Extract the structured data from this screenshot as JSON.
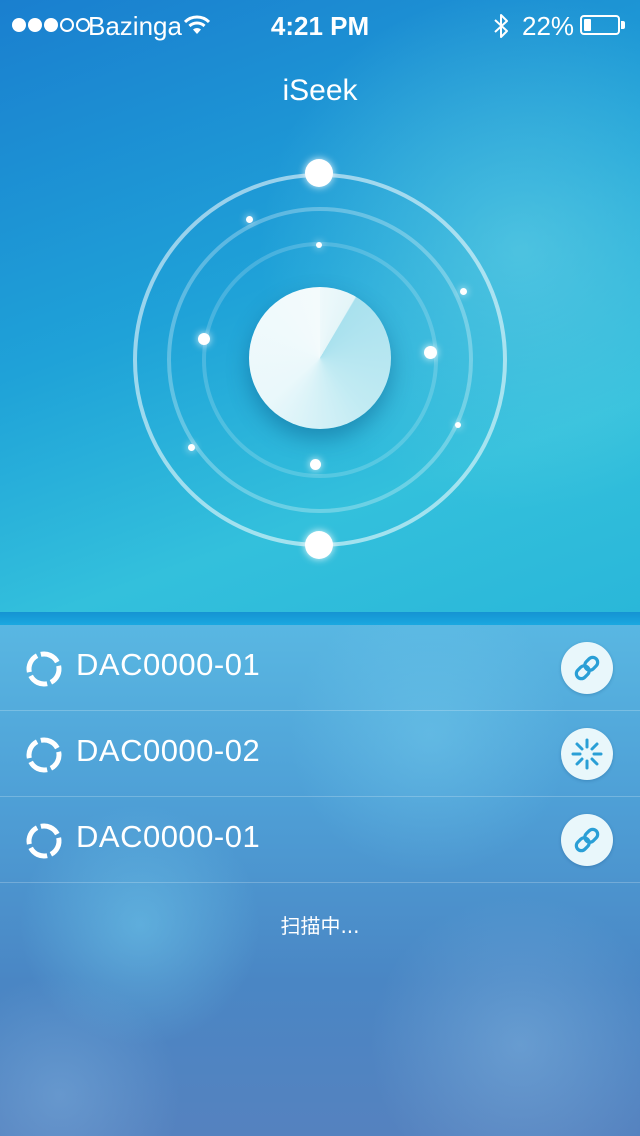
{
  "status_bar": {
    "carrier": "Bazinga",
    "time": "4:21 PM",
    "battery_percent": "22%",
    "battery_level": 0.22,
    "signal_strength": 3,
    "signal_max": 5
  },
  "app": {
    "title": "iSeek"
  },
  "devices": [
    {
      "name": "DAC0000-01",
      "action_icon": "link-icon"
    },
    {
      "name": "DAC0000-02",
      "action_icon": "spinner-icon"
    },
    {
      "name": "DAC0000-01",
      "action_icon": "link-icon"
    }
  ],
  "scan_status": "扫描中...",
  "colors": {
    "accent": "#1ea8d9",
    "icon_blue": "#2a9fd6",
    "button_bg": "#e9f7fb"
  }
}
